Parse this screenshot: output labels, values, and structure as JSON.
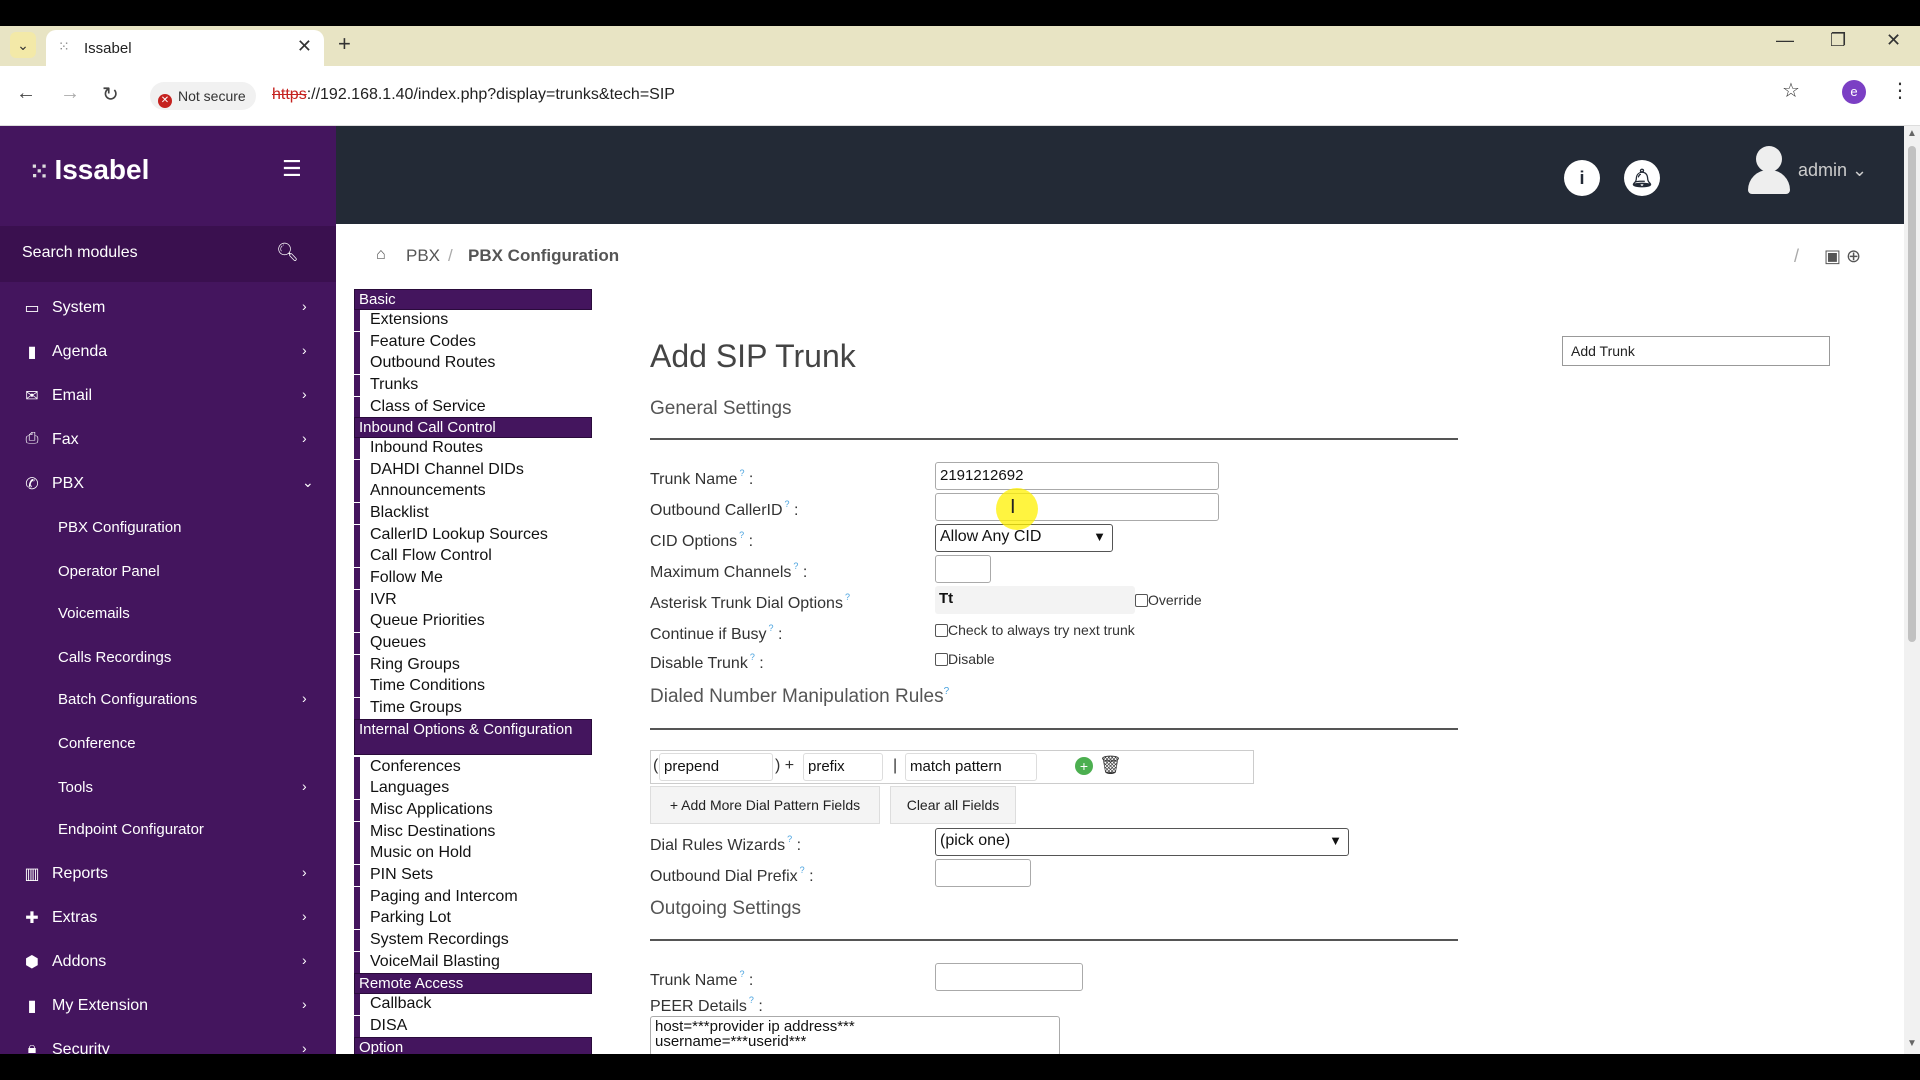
{
  "browser": {
    "tab_title": "Issabel",
    "security_label": "Not secure",
    "url_scheme": "https",
    "url_rest": "://192.168.1.40/index.php?display=trunks&tech=SIP",
    "profile_initial": "e"
  },
  "sidebar": {
    "brand": "Issabel",
    "search_label": "Search modules",
    "items": [
      {
        "label": "System",
        "icon": "laptop-icon"
      },
      {
        "label": "Agenda",
        "icon": "book-icon"
      },
      {
        "label": "Email",
        "icon": "envelope-icon"
      },
      {
        "label": "Fax",
        "icon": "printer-icon"
      },
      {
        "label": "PBX",
        "icon": "phone-icon"
      },
      {
        "label": "PBX Configuration"
      },
      {
        "label": "Operator Panel"
      },
      {
        "label": "Voicemails"
      },
      {
        "label": "Calls Recordings"
      },
      {
        "label": "Batch Configurations"
      },
      {
        "label": "Conference"
      },
      {
        "label": "Tools"
      },
      {
        "label": "Endpoint Configurator"
      },
      {
        "label": "Reports",
        "icon": "chart-icon"
      },
      {
        "label": "Extras",
        "icon": "plus-icon"
      },
      {
        "label": "Addons",
        "icon": "cubes-icon"
      },
      {
        "label": "My Extension",
        "icon": "book-icon"
      },
      {
        "label": "Security",
        "icon": "lock-icon"
      }
    ]
  },
  "header": {
    "user": "admin"
  },
  "breadcrumb": {
    "level1": "PBX",
    "level2": "PBX Configuration"
  },
  "pbxnav": {
    "sections": [
      {
        "header": "Basic",
        "items": [
          "Extensions",
          "Feature Codes",
          "Outbound Routes",
          "Trunks",
          "Class of Service"
        ]
      },
      {
        "header": "Inbound Call Control",
        "items": [
          "Inbound Routes",
          "DAHDI Channel DIDs",
          "Announcements",
          "Blacklist",
          "CallerID Lookup Sources",
          "Call Flow Control",
          "Follow Me",
          "IVR",
          "Queue Priorities",
          "Queues",
          "Ring Groups",
          "Time Conditions",
          "Time Groups"
        ]
      },
      {
        "header": "Internal Options & Configuration",
        "items": [
          "Conferences",
          "Languages",
          "Misc Applications",
          "Misc Destinations",
          "Music on Hold",
          "PIN Sets",
          "Paging and Intercom",
          "Parking Lot",
          "System Recordings",
          "VoiceMail Blasting"
        ]
      },
      {
        "header": "Remote Access",
        "items": [
          "Callback",
          "DISA"
        ]
      },
      {
        "header": "Option",
        "items": []
      }
    ]
  },
  "form": {
    "title": "Add SIP Trunk",
    "general_settings": "General Settings",
    "trunk_name_label": "Trunk Name",
    "trunk_name_value": "2191212692",
    "outbound_callerid_label": "Outbound CallerID",
    "outbound_callerid_value": "",
    "cid_options_label": "CID Options",
    "cid_options_value": "Allow Any CID",
    "max_channels_label": "Maximum Channels",
    "max_channels_value": "",
    "dial_options_label": "Asterisk Trunk Dial Options",
    "dial_options_value": "Tt",
    "override_label": "Override",
    "continue_busy_label": "Continue if Busy",
    "continue_busy_check": "Check to always try next trunk",
    "disable_trunk_label": "Disable Trunk",
    "disable_check": "Disable",
    "dnm_rules": "Dialed Number Manipulation Rules",
    "prepend_ph": "prepend",
    "prefix_ph": "prefix",
    "match_ph": "match pattern",
    "add_more_btn": "+ Add More Dial Pattern Fields",
    "clear_btn": "Clear all Fields",
    "dial_wizards_label": "Dial Rules Wizards",
    "dial_wizards_value": "(pick one)",
    "outbound_prefix_label": "Outbound Dial Prefix",
    "outgoing_settings": "Outgoing Settings",
    "out_trunk_name_label": "Trunk Name",
    "peer_details_label": "PEER Details",
    "peer_details_value": "host=***provider ip address***\nusername=***userid***"
  },
  "right_panel": {
    "add_trunk": "Add Trunk"
  },
  "colors": {
    "sidebar": "#44155e",
    "header": "#232a36",
    "tabstrip": "#e8e4c4"
  }
}
